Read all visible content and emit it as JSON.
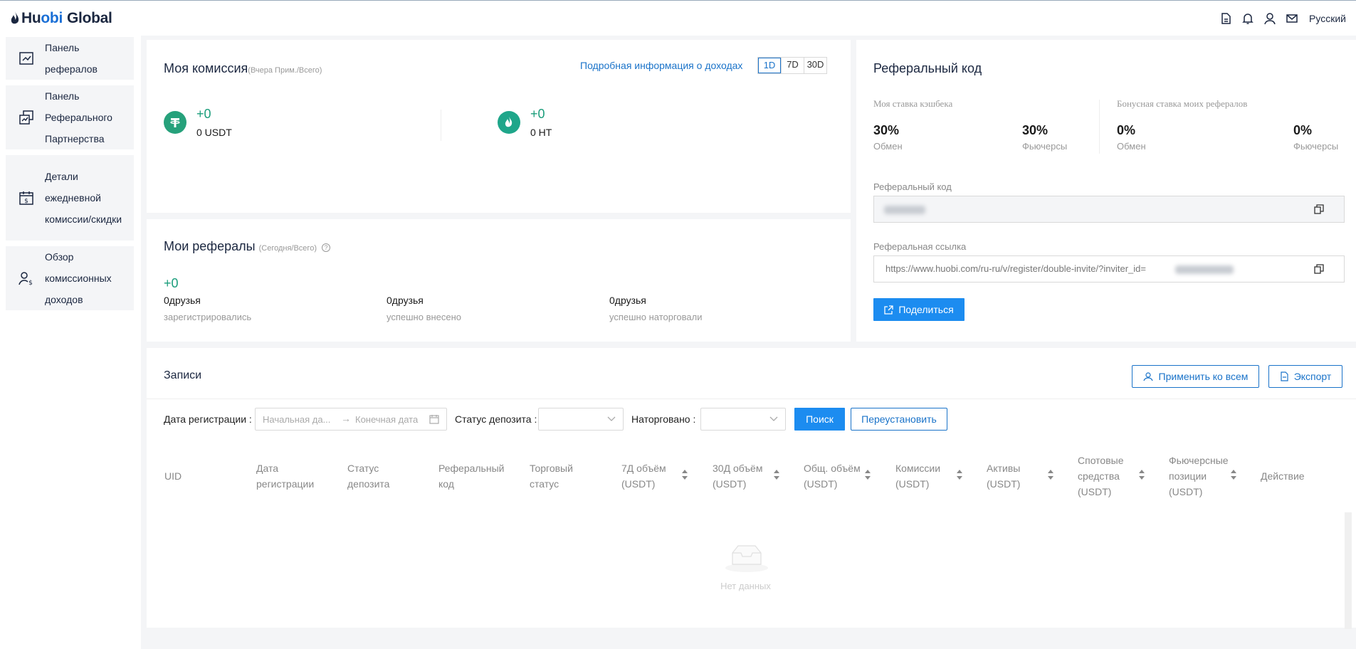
{
  "header": {
    "brand_part1": "Hu",
    "brand_part2": "obi",
    "brand_part3": "Global",
    "language": "Русский"
  },
  "sidebar": {
    "items": [
      {
        "label": "Панель рефералов",
        "icon": "chart-icon"
      },
      {
        "label": "Панель Реферального Партнерства",
        "icon": "partnership-icon"
      },
      {
        "label": "Детали ежедневной комиссии/скидки",
        "icon": "calendar-dollar-icon"
      },
      {
        "label": "Обзор комиссионных доходов",
        "icon": "user-dollar-icon"
      }
    ]
  },
  "commission": {
    "title": "Моя комиссия",
    "subtitle": "(Вчера Прим./Всего)",
    "details_link": "Подробная информация о доходах",
    "periods": [
      "1D",
      "7D",
      "30D"
    ],
    "usdt_delta": "+0",
    "usdt_total": "0 USDT",
    "ht_delta": "+0",
    "ht_total": "0 HT"
  },
  "referrals": {
    "title": "Мои рефералы",
    "subtitle": "(Сегодня/Всего)",
    "delta": "+0",
    "stats": [
      {
        "value": "0друзья",
        "label": "зарегистрировались"
      },
      {
        "value": "0друзья",
        "label": "успешно внесено"
      },
      {
        "value": "0друзья",
        "label": "успешно наторговали"
      }
    ]
  },
  "ref_code": {
    "title": "Реферальный код",
    "my_rate_label": "Моя ставка кэшбека",
    "bonus_rate_label": "Бонусная ставка моих рефералов",
    "my_exchange": "30%",
    "my_exchange_label": "Обмен",
    "my_futures": "30%",
    "my_futures_label": "Фьючерсы",
    "bonus_exchange": "0%",
    "bonus_exchange_label": "Обмен",
    "bonus_futures": "0%",
    "bonus_futures_label": "Фьючерсы",
    "code_label": "Реферальный код",
    "link_label": "Реферальная ссылка",
    "link_value": "https://www.huobi.com/ru-ru/v/register/double-invite/?inviter_id=",
    "share_button": "Поделиться"
  },
  "records": {
    "title": "Записи",
    "apply_all": "Применить ко всем",
    "export": "Экспорт",
    "reg_date_label": "Дата регистрации :",
    "start_placeholder": "Начальная да...",
    "end_placeholder": "Конечная дата",
    "deposit_status_label": "Статус депозита :",
    "traded_label": "Наторговано :",
    "search_button": "Поиск",
    "reset_button": "Переустановить",
    "columns": [
      "UID",
      "Дата регистрации",
      "Статус депозита",
      "Реферальный код",
      "Торговый статус",
      "7Д объём (USDT)",
      "30Д объём (USDT)",
      "Общ. объём (USDT)",
      "Комиссии (USDT)",
      "Активы (USDT)",
      "Спотовые средства (USDT)",
      "Фьючерсные позиции (USDT)",
      "Действие"
    ],
    "empty_text": "Нет данных"
  }
}
